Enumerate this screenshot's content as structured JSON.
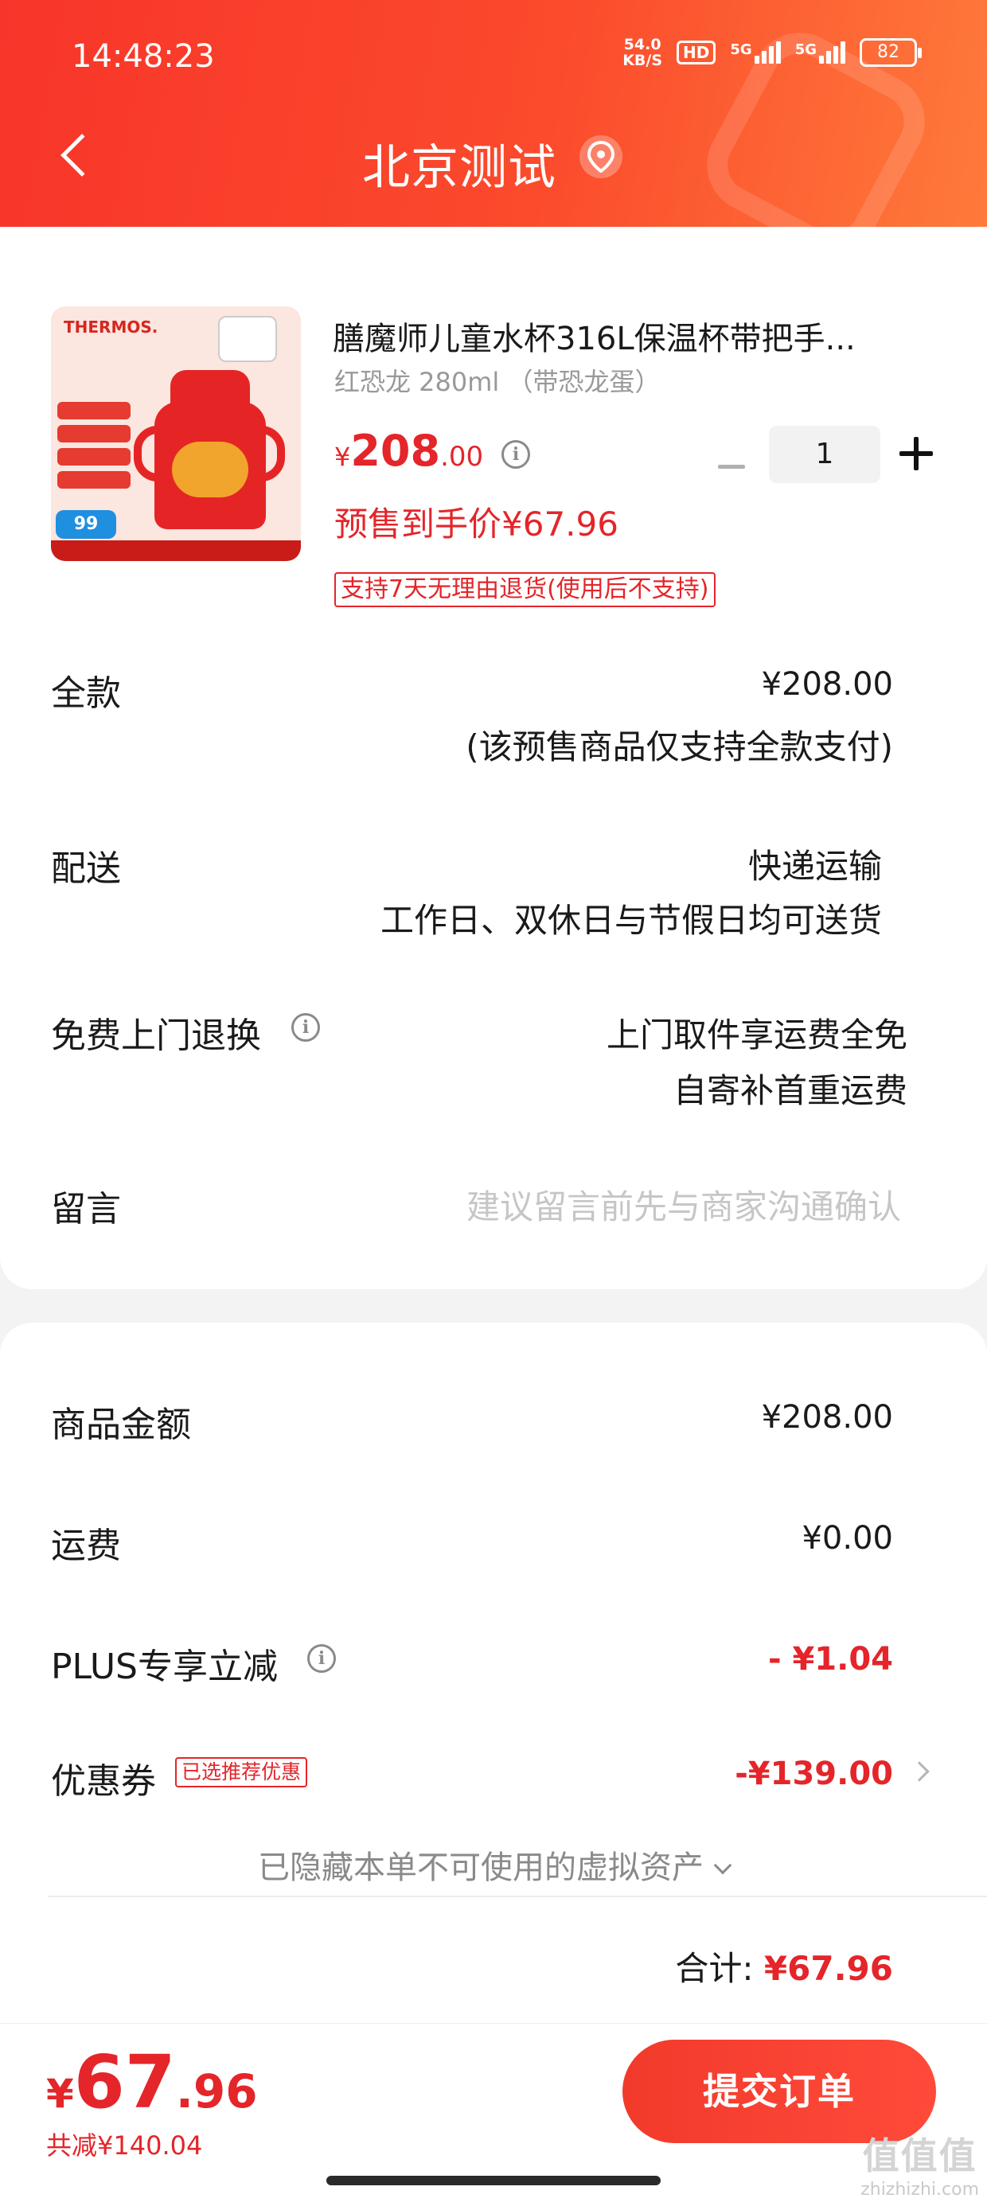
{
  "status_bar": {
    "time": "14:48:23",
    "speed_value": "54.0",
    "speed_unit": "KB/S",
    "hd": "HD",
    "sig1": "5G",
    "sig2": "5G",
    "battery": "82"
  },
  "header": {
    "title": "北京测试"
  },
  "product": {
    "title": "膳魔师儿童水杯316L保温杯带把手...",
    "spec": "红恐龙 280ml （带恐龙蛋）",
    "image_brand": "THERMOS.",
    "image_price_badge": "99",
    "price_yen": "¥",
    "price_int": "208",
    "price_dec": ".00",
    "quantity": "1",
    "presale_price": "预售到手价¥67.96",
    "return_tag": "支持7天无理由退货(使用后不支持)"
  },
  "order": {
    "full_payment": {
      "label": "全款",
      "value": "¥208.00",
      "note": "(该预售商品仅支持全款支付)"
    },
    "delivery": {
      "label": "配送",
      "method": "快递运输",
      "note": "工作日、双休日与节假日均可送货"
    },
    "free_return": {
      "label": "免费上门退换",
      "line1": "上门取件享运费全免",
      "line2": "自寄补首重运费"
    },
    "message": {
      "label": "留言",
      "placeholder": "建议留言前先与商家沟通确认"
    }
  },
  "summary": {
    "goods_amount": {
      "label": "商品金额",
      "value": "¥208.00"
    },
    "shipping": {
      "label": "运费",
      "value": "¥0.00"
    },
    "plus": {
      "label": "PLUS专享立减",
      "value": "- ¥1.04"
    },
    "coupon": {
      "label": "优惠券",
      "tag": "已选推荐优惠",
      "value": "-¥139.00"
    },
    "hidden_assets": "已隐藏本单不可使用的虚拟资产",
    "total_label": "合计:",
    "total_value": "¥67.96"
  },
  "bottom": {
    "pay_yen": "¥",
    "pay_int": "67",
    "pay_dec": ".96",
    "discount": "共减¥140.04",
    "submit": "提交订单"
  },
  "watermark": {
    "top": "值值值",
    "bottom": "zhizhizhi.com"
  },
  "colors": {
    "accent": "#e4252a",
    "header_start": "#f8352a",
    "header_end": "#ff7a3b"
  },
  "icons": [
    "back-icon",
    "location-icon",
    "info-icon",
    "chevron-down-icon",
    "chevron-right-icon",
    "plus-icon",
    "minus-icon"
  ]
}
